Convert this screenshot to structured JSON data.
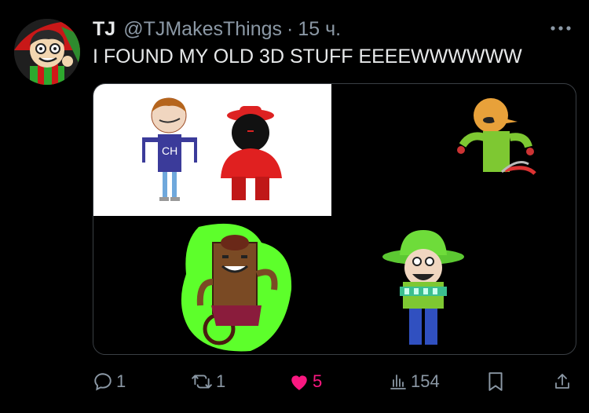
{
  "tweet": {
    "display_name": "TJ",
    "handle": "@TJMakesThings",
    "separator": "·",
    "time": "15 ч.",
    "text": "I FOUND MY OLD 3D STUFF EEEEWWWWWW",
    "more_icon": "more-horizontal-icon"
  },
  "media": {
    "images": [
      {
        "description": "3D character with CH shirt and red blob character on white background"
      },
      {
        "description": "3D orange-headed character with green body"
      },
      {
        "description": "3D brown box character in wheelchair with green glow"
      },
      {
        "description": "3D character with green hat and bandolier"
      }
    ]
  },
  "actions": {
    "replies": {
      "icon": "reply-icon",
      "count": "1"
    },
    "retweets": {
      "icon": "retweet-icon",
      "count": "1"
    },
    "likes": {
      "icon": "heart-icon",
      "count": "5",
      "liked": true
    },
    "views": {
      "icon": "views-icon",
      "count": "154"
    },
    "bookmark": {
      "icon": "bookmark-icon"
    },
    "share": {
      "icon": "share-icon"
    }
  },
  "colors": {
    "background": "#000000",
    "text": "#e7e9ea",
    "secondary": "#8b98a5",
    "like": "#f91880",
    "glow_green": "#5dff2b"
  }
}
